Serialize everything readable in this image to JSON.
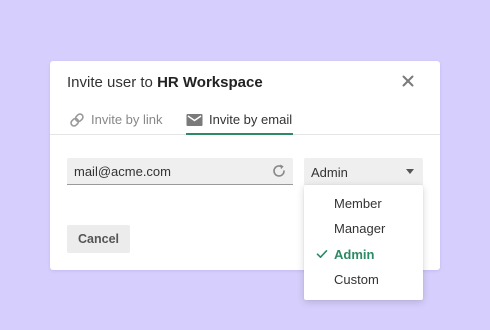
{
  "dialog": {
    "title_prefix": "Invite user to",
    "workspace_name": "HR Workspace",
    "close_icon": "close-icon"
  },
  "tabs": [
    {
      "label": "Invite by link",
      "icon": "link-icon",
      "active": false
    },
    {
      "label": "Invite by email",
      "icon": "mail-icon",
      "active": true
    }
  ],
  "email_field": {
    "value": "mail@acme.com",
    "icon": "refresh-icon"
  },
  "role_select": {
    "selected": "Admin",
    "icon": "caret-down-icon"
  },
  "actions": {
    "cancel_label": "Cancel"
  },
  "role_dropdown": {
    "options": [
      {
        "label": "Member",
        "selected": false
      },
      {
        "label": "Manager",
        "selected": false
      },
      {
        "label": "Admin",
        "selected": true
      },
      {
        "label": "Custom",
        "selected": false
      }
    ]
  },
  "colors": {
    "background": "#d6cffd",
    "accent": "#2c8a66",
    "field_bg": "#efefef",
    "muted_text": "#888888"
  }
}
